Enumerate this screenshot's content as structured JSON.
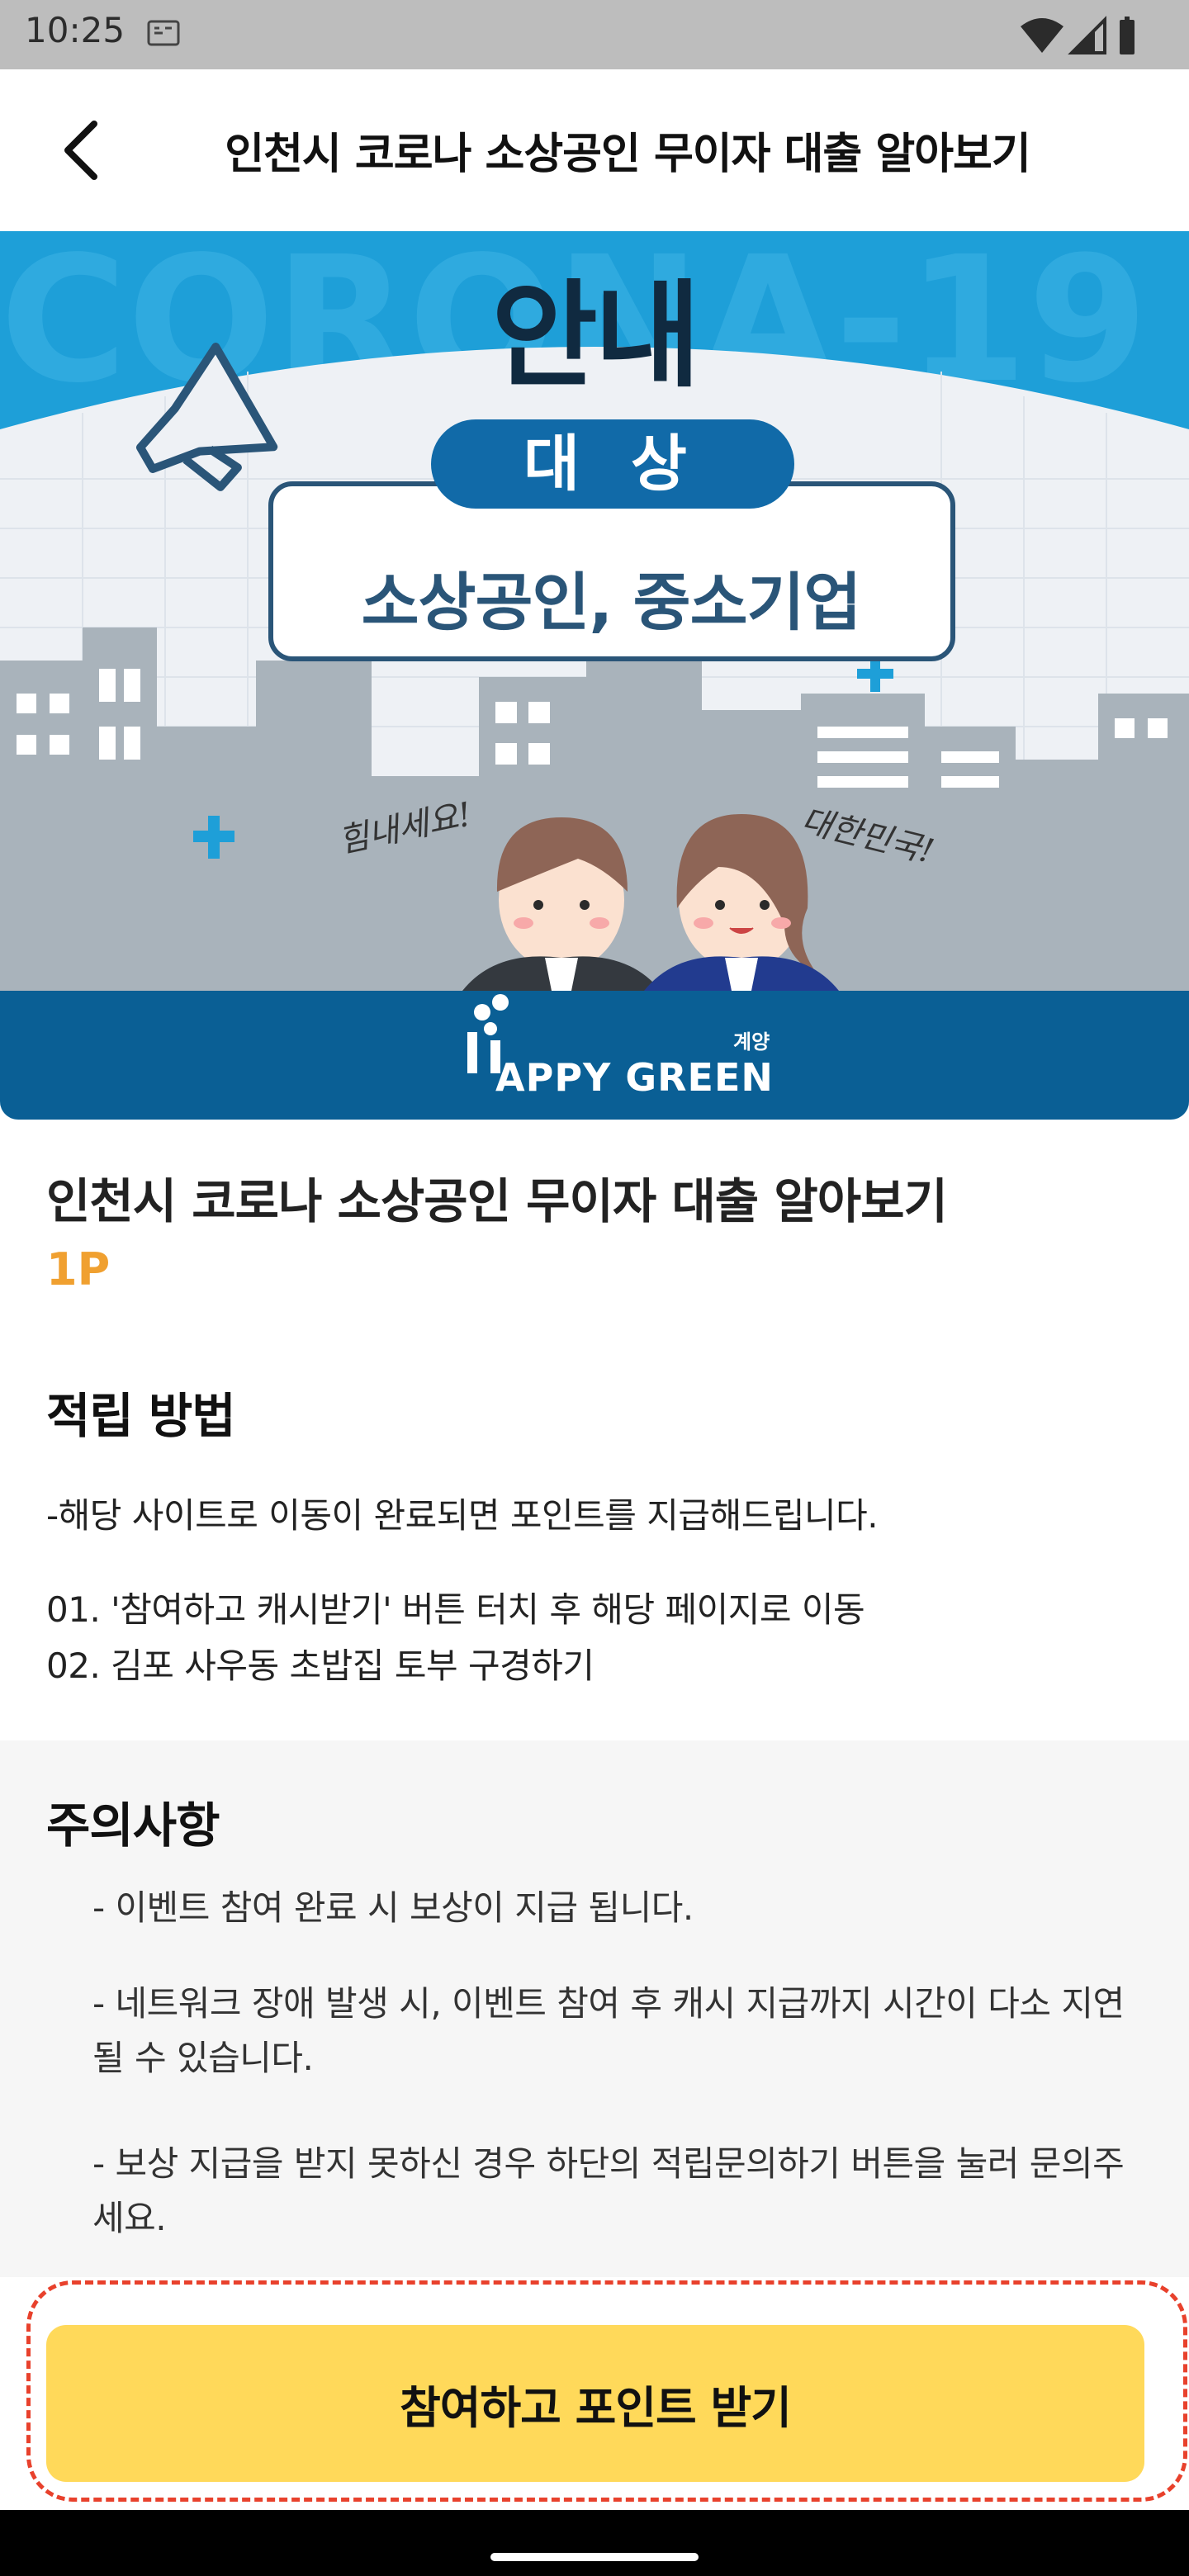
{
  "status_bar": {
    "time": "10:25",
    "notification_icon": "sd-card-icon",
    "icons": [
      "wifi-icon",
      "signal-icon",
      "battery-icon"
    ]
  },
  "app_bar": {
    "back_icon": "chevron-left-icon",
    "title": "인천시 코로나 소상공인 무이자 대출 알아보기"
  },
  "banner": {
    "heading": "안내",
    "background_text": "CORONA-19",
    "pill_label": "대 상",
    "target_text": "소상공인, 중소기업",
    "speech_left": "힘내세요!",
    "speech_right": "대한민국!",
    "logo_text": "APPY GREEN",
    "logo_small_text": "계양",
    "colors": {
      "sky": "#1e9fd8",
      "pill": "#116aa8",
      "footer": "#0a5f95",
      "buildings": "#a9b3bb"
    }
  },
  "campaign": {
    "title": "인천시 코로나 소상공인 무이자 대출 알아보기",
    "points": "1P"
  },
  "method": {
    "heading": "적립 방법",
    "lines": [
      "-해당 사이트로 이동이 완료되면 포인트를 지급해드립니다.",
      "01. '참여하고 캐시받기' 버튼 터치 후 해당 페이지로 이동",
      "02. 김포 사우동 초밥집 토부 구경하기"
    ]
  },
  "notice": {
    "heading": "주의사항",
    "items": [
      "- 이벤트 참여 완료 시 보상이 지급 됩니다.",
      "- 네트워크 장애 발생 시, 이벤트 참여 후 캐시 지급까지 시간이 다소 지연될 수 있습니다.",
      "- 보상 지급을 받지 못하신 경우 하단의 적립문의하기 버튼을 눌러 문의주세요."
    ]
  },
  "cta": {
    "label": "참여하고 포인트 받기",
    "color": "#ffd95a",
    "highlight_color": "#e8412c"
  }
}
